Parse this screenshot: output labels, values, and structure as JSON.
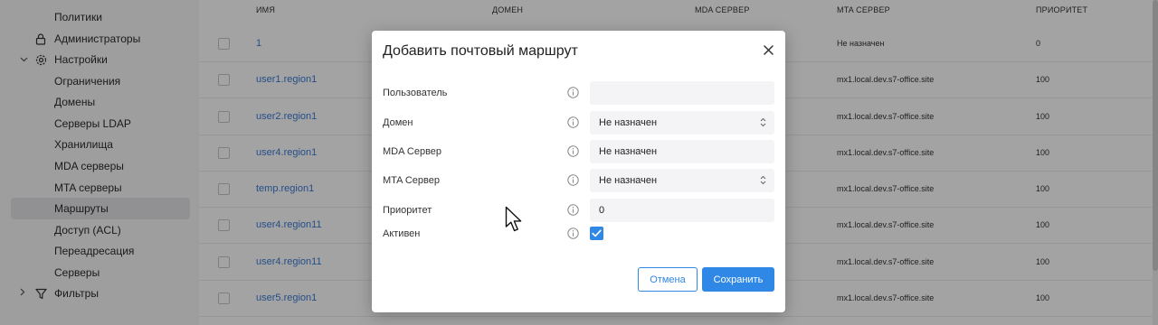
{
  "sidebar": {
    "items": [
      {
        "label": "Политики"
      },
      {
        "label": "Администраторы"
      },
      {
        "label": "Настройки"
      },
      {
        "label": "Ограничения"
      },
      {
        "label": "Домены"
      },
      {
        "label": "Серверы LDAP"
      },
      {
        "label": "Хранилища"
      },
      {
        "label": "MDA серверы"
      },
      {
        "label": "MTA серверы"
      },
      {
        "label": "Маршруты"
      },
      {
        "label": "Доступ (ACL)"
      },
      {
        "label": "Переадресация"
      },
      {
        "label": "Серверы"
      },
      {
        "label": "Фильтры"
      }
    ],
    "active_item": "Маршруты"
  },
  "table": {
    "headers": [
      "ИМЯ",
      "ДОМЕН",
      "MDA СЕРВЕР",
      "MTA СЕРВЕР",
      "ПРИОРИТЕТ"
    ],
    "rows": [
      {
        "name": "1",
        "mta": "Не назначен",
        "priority": "0"
      },
      {
        "name": "user1.region1",
        "mta": "mx1.local.dev.s7-office.site",
        "priority": "100"
      },
      {
        "name": "user2.region1",
        "mta": "mx1.local.dev.s7-office.site",
        "priority": "100"
      },
      {
        "name": "user4.region1",
        "mta": "mx1.local.dev.s7-office.site",
        "priority": "100"
      },
      {
        "name": "temp.region1",
        "mta": "mx1.local.dev.s7-office.site",
        "priority": "100"
      },
      {
        "name": "user4.region11",
        "mta": "mx1.local.dev.s7-office.site",
        "priority": "100"
      },
      {
        "name": "user4.region11",
        "mta": "mx1.local.dev.s7-office.site",
        "priority": "100"
      },
      {
        "name": "user5.region1",
        "mta": "mx1.local.dev.s7-office.site",
        "priority": "100"
      }
    ]
  },
  "modal": {
    "title": "Добавить почтовый маршрут",
    "fields": {
      "user": {
        "label": "Пользователь",
        "value": ""
      },
      "domain": {
        "label": "Домен",
        "value": "Не назначен"
      },
      "mda": {
        "label": "MDA Сервер",
        "value": "Не назначен"
      },
      "mta": {
        "label": "MTA Сервер",
        "value": "Не назначен"
      },
      "priority": {
        "label": "Приоритет",
        "value": "0"
      },
      "active": {
        "label": "Активен",
        "checked": true
      }
    },
    "cancel_label": "Отмена",
    "save_label": "Сохранить"
  },
  "colors": {
    "accent": "#2f87e6",
    "link": "#3a7bd5",
    "overlay": "rgba(0,0,0,0.36)"
  }
}
